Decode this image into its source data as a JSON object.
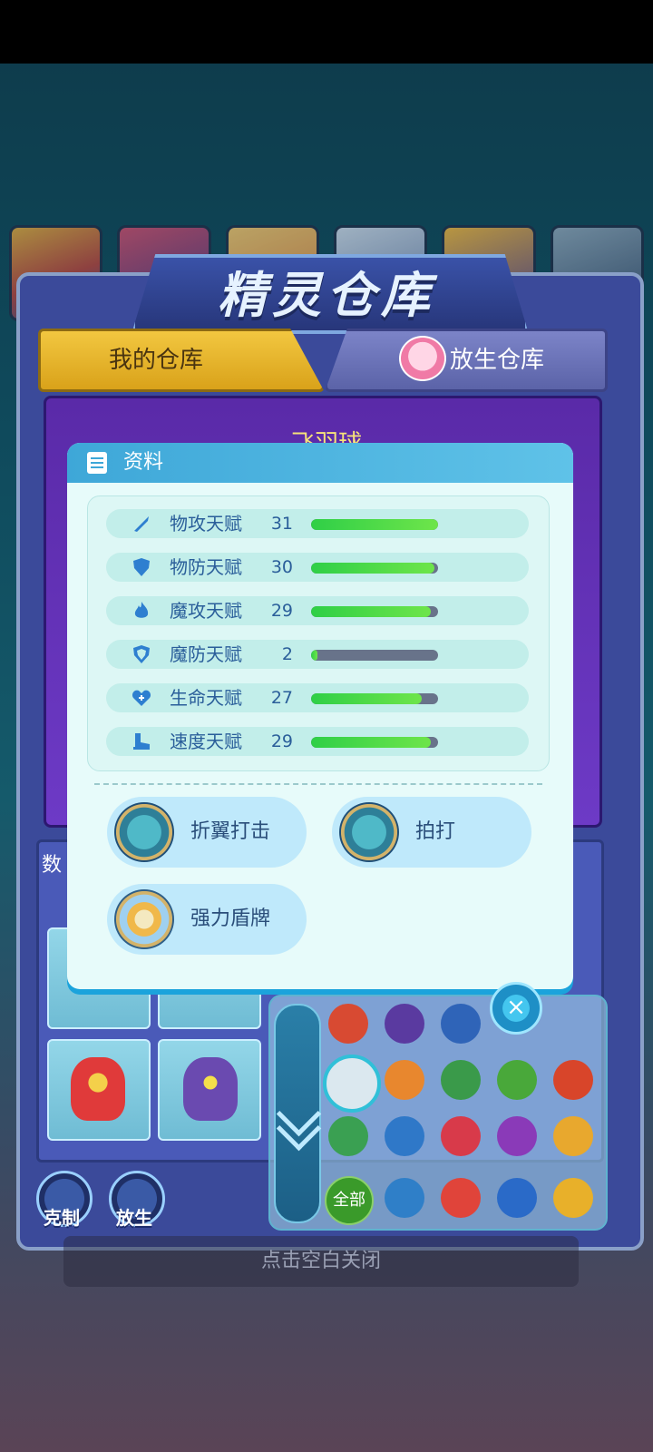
{
  "header": {
    "title": "精灵仓库"
  },
  "tabs": [
    {
      "label": "我的仓库",
      "active": true
    },
    {
      "label": "放生仓库",
      "active": false
    }
  ],
  "background": {
    "pet_name": "飞羽球",
    "sort_label": "数"
  },
  "dialog": {
    "title": "资料",
    "stats": [
      {
        "label": "物攻天赋",
        "value": "31",
        "level": 1.0,
        "icon": "sword-icon"
      },
      {
        "label": "物防天赋",
        "value": "30",
        "level": 0.97,
        "icon": "shield-icon"
      },
      {
        "label": "魔攻天赋",
        "value": "29",
        "level": 0.94,
        "icon": "fire-icon"
      },
      {
        "label": "魔防天赋",
        "value": "2",
        "level": 0.05,
        "icon": "magic-shield-icon"
      },
      {
        "label": "生命天赋",
        "value": "27",
        "level": 0.87,
        "icon": "heart-plus-icon"
      },
      {
        "label": "速度天赋",
        "value": "29",
        "level": 0.94,
        "icon": "boot-icon"
      }
    ],
    "skills": [
      {
        "label": "折翼打击",
        "icon": "wing-icon"
      },
      {
        "label": "拍打",
        "icon": "wing-icon"
      },
      {
        "label": "强力盾牌",
        "icon": "shield-emblem-icon"
      }
    ],
    "colors": {
      "bar_fill": "#2fcf47",
      "bar_track": "#68738a",
      "header": "#3ea7d8"
    }
  },
  "bottom_buttons": [
    {
      "label": "克制",
      "icon": "counter-icon"
    },
    {
      "label": "放生",
      "icon": "release-icon"
    }
  ],
  "filter": {
    "all_label": "全部",
    "close_symbol": "×"
  },
  "footer": {
    "hint": "点击空白关闭"
  }
}
